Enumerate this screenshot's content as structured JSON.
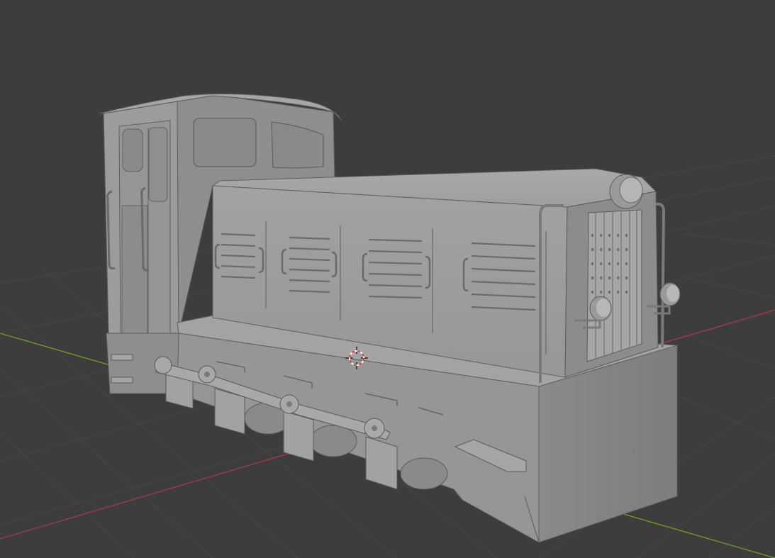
{
  "viewport": {
    "background_color": "#3d3d3d",
    "grid_line_color": "#484848",
    "x_axis_color": "#a03a45",
    "y_axis_color": "#6e9a2c",
    "model_base_color": "#9a9a9a",
    "model_light_color": "#a8a8a8",
    "model_dark_color": "#6f6f6f",
    "model_edge_color": "#5a5a5a",
    "cursor_color_a": "#d83a3a",
    "cursor_color_b": "#ffffff",
    "cursor_icon": "3d-cursor-icon",
    "object": "diesel-shunter-locomotive-mesh"
  }
}
